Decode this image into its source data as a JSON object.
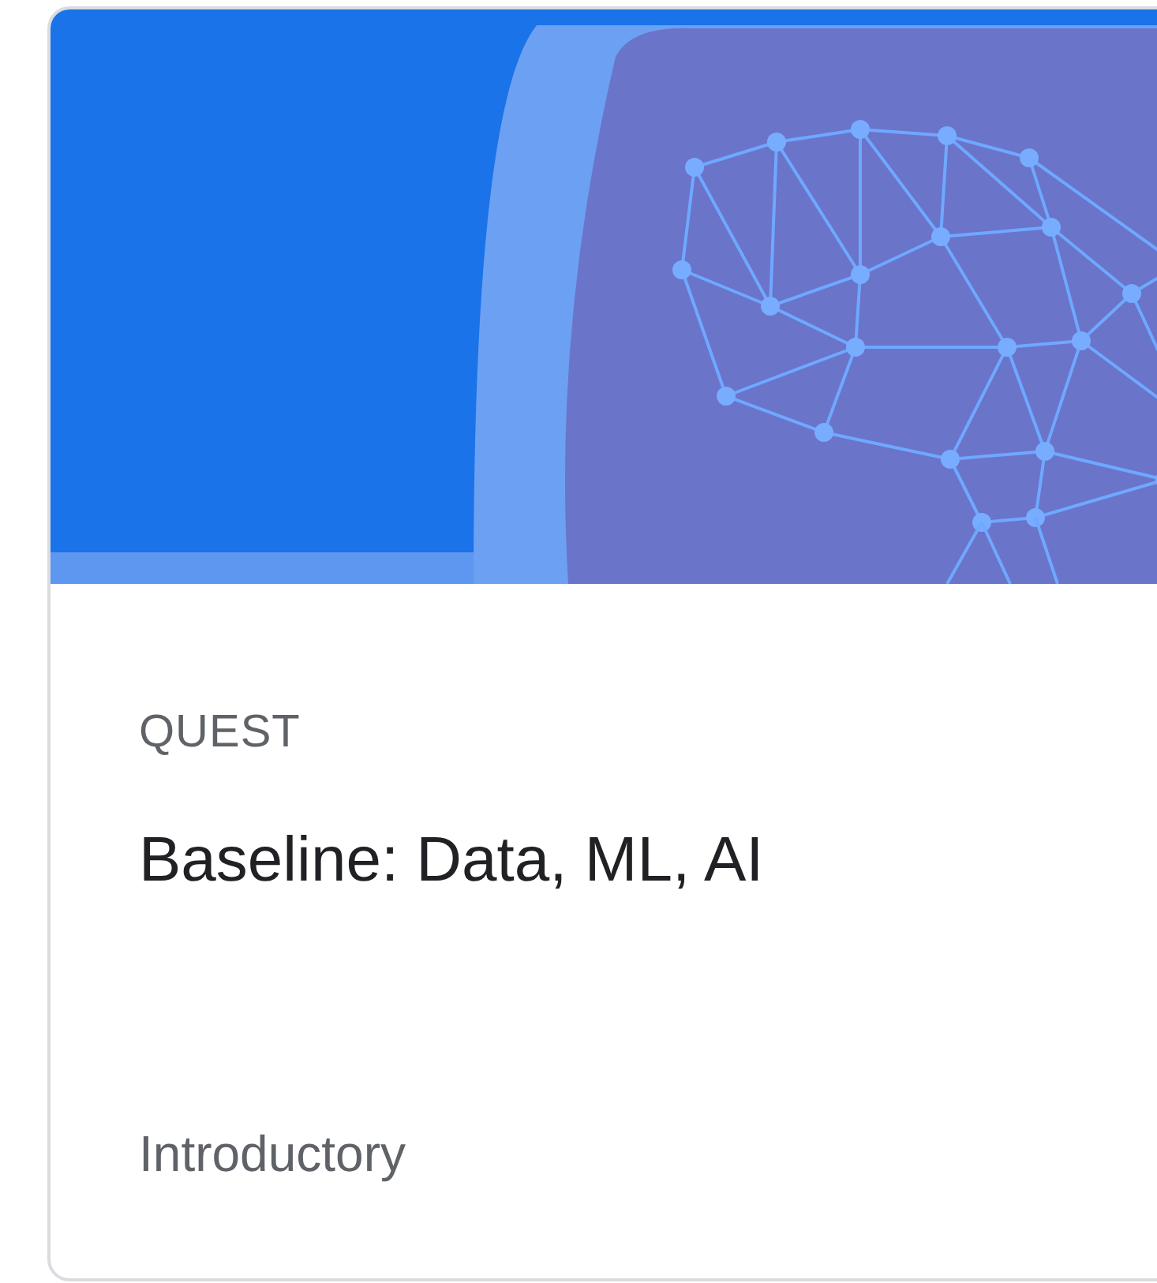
{
  "card": {
    "category": "QUEST",
    "title": "Baseline: Data, ML, AI",
    "difficulty": "Introductory"
  }
}
